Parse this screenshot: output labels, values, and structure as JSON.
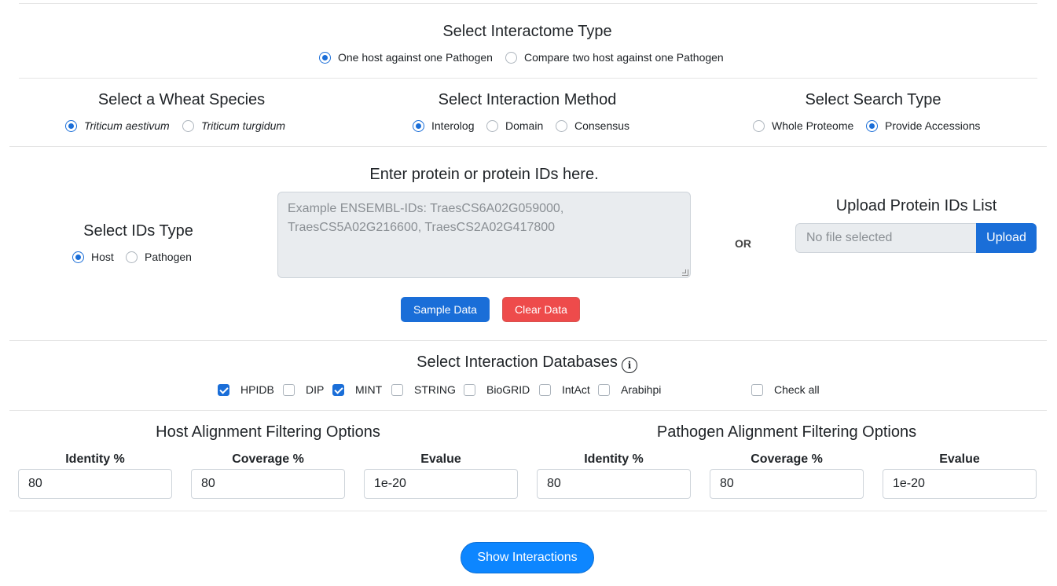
{
  "interactome": {
    "title": "Select Interactome Type",
    "options": [
      "One host against one Pathogen",
      "Compare two host against one Pathogen"
    ],
    "selected": 0
  },
  "wheat": {
    "title": "Select a Wheat Species",
    "options": [
      "Triticum aestivum",
      "Triticum turgidum"
    ],
    "selected": 0
  },
  "method": {
    "title": "Select Interaction Method",
    "options": [
      "Interolog",
      "Domain",
      "Consensus"
    ],
    "selected": 0
  },
  "search": {
    "title": "Select Search Type",
    "options": [
      "Whole Proteome",
      "Provide Accessions"
    ],
    "selected": 1
  },
  "ids_type": {
    "title": "Select IDs Type",
    "options": [
      "Host",
      "Pathogen"
    ],
    "selected": 0
  },
  "protein_entry": {
    "title": "Enter protein or protein IDs here.",
    "placeholder": "Example ENSEMBL-IDs: TraesCS6A02G059000, TraesCS5A02G216600, TraesCS2A02G417800",
    "sample_button": "Sample Data",
    "clear_button": "Clear Data"
  },
  "or_label": "OR",
  "upload": {
    "title": "Upload Protein IDs List",
    "file_placeholder": "No file selected",
    "button": "Upload"
  },
  "databases": {
    "title": "Select Interaction Databases",
    "info_icon": "info-icon",
    "items": [
      {
        "label": "HPIDB",
        "checked": true
      },
      {
        "label": "DIP",
        "checked": false
      },
      {
        "label": "MINT",
        "checked": true
      },
      {
        "label": "STRING",
        "checked": false
      },
      {
        "label": "BioGRID",
        "checked": false
      },
      {
        "label": "IntAct",
        "checked": false
      },
      {
        "label": "Arabihpi",
        "checked": false
      }
    ],
    "check_all": "Check all"
  },
  "host_filter": {
    "title": "Host Alignment Filtering Options",
    "identity_label": "Identity %",
    "identity": "80",
    "coverage_label": "Coverage %",
    "coverage": "80",
    "evalue_label": "Evalue",
    "evalue": "1e-20"
  },
  "pathogen_filter": {
    "title": "Pathogen Alignment Filtering Options",
    "identity_label": "Identity %",
    "identity": "80",
    "coverage_label": "Coverage %",
    "coverage": "80",
    "evalue_label": "Evalue",
    "evalue": "1e-20"
  },
  "submit": "Show Interactions",
  "colors": {
    "primary": "#1a6ed8",
    "danger": "#ee4b4b",
    "submit": "#0d86ff"
  }
}
